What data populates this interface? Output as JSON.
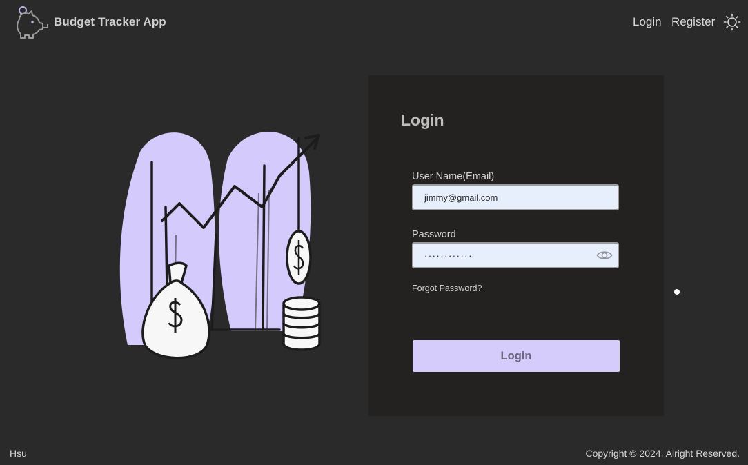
{
  "header": {
    "app_title": "Budget Tracker App",
    "nav": {
      "login": "Login",
      "register": "Register"
    },
    "icons": {
      "logo": "piggy-bank-icon",
      "theme": "sun-icon"
    }
  },
  "login_card": {
    "title": "Login",
    "username": {
      "label": "User Name(Email)",
      "value": "jimmy@gmail.com"
    },
    "password": {
      "label": "Password",
      "value": "············"
    },
    "forgot_password": "Forgot Password?",
    "submit_label": "Login"
  },
  "footer": {
    "left": "Hsu",
    "copyright": "Copyright © 2024. Alright Reserved."
  },
  "colors": {
    "background": "#2a2a2a",
    "card": "#242220",
    "accent": "#d5ccfb",
    "input_bg": "#e8effc"
  }
}
